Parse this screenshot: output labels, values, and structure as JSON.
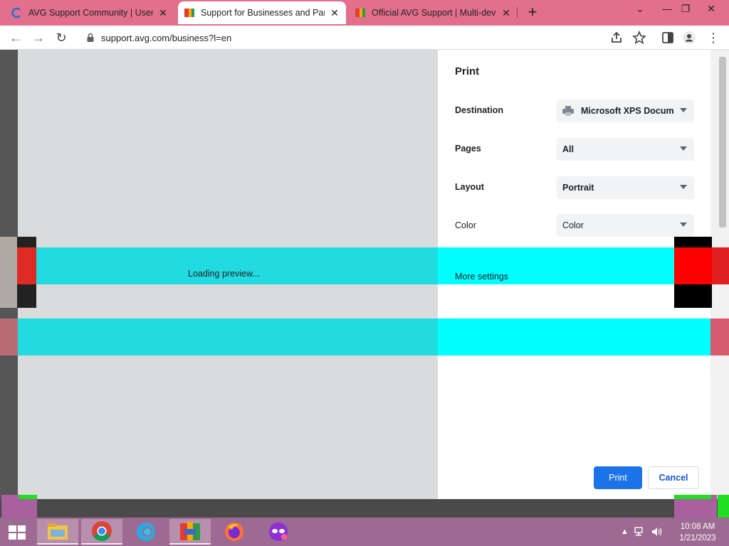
{
  "browser": {
    "tabs": [
      {
        "title": "AVG Support Community | User F",
        "favicon": "community-c-icon",
        "active": false
      },
      {
        "title": "Support for Businesses and Partn",
        "favicon": "avg-logo-icon",
        "active": true
      },
      {
        "title": "Official AVG Support | Multi-devi",
        "favicon": "avg-logo-icon",
        "active": false
      }
    ],
    "new_tab": "+",
    "url": "support.avg.com/business?l=en"
  },
  "preview": {
    "loading_text": "Loading preview..."
  },
  "print_dialog": {
    "title": "Print",
    "destination": {
      "label": "Destination",
      "value": "Microsoft XPS Docum"
    },
    "pages": {
      "label": "Pages",
      "value": "All"
    },
    "layout": {
      "label": "Layout",
      "value": "Portrait"
    },
    "color": {
      "label": "Color",
      "value": "Color"
    },
    "more_settings": "More settings",
    "print_button": "Print",
    "cancel_button": "Cancel"
  },
  "taskbar": {
    "apps": [
      "file-explorer-icon",
      "chrome-icon",
      "edge-icon",
      "avg-icon",
      "firefox-icon",
      "incognito-app-icon"
    ],
    "time": "10:08 AM",
    "date": "1/21/2023"
  },
  "colors": {
    "tabbar": "#e2708c",
    "overlay_cyan": "#00ffff",
    "print_blue": "#1a73e8",
    "taskbar": "#9c6a92"
  }
}
